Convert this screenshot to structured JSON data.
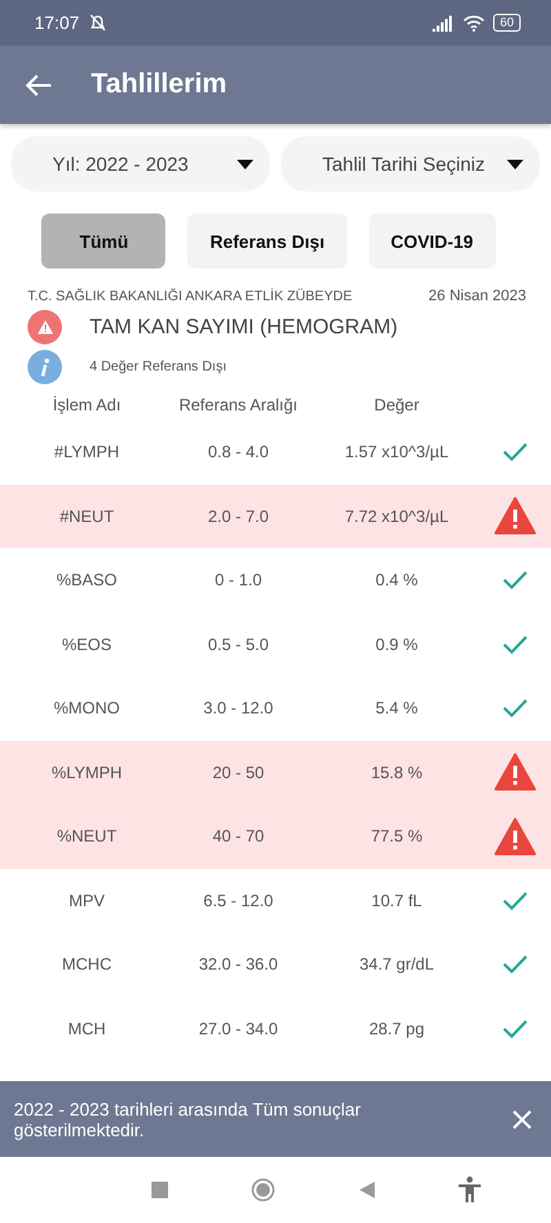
{
  "status_bar": {
    "time": "17:07",
    "battery": "60"
  },
  "app_bar": {
    "title": "Tahlillerim"
  },
  "filters": [
    {
      "label": "Yıl: 2022 - 2023"
    },
    {
      "label": "Tahlil Tarihi Seçiniz"
    }
  ],
  "tabs": [
    {
      "label": "Tümü",
      "selected": true
    },
    {
      "label": "Referans Dışı",
      "selected": false
    },
    {
      "label": "COVID-19",
      "selected": false
    }
  ],
  "report": {
    "institution": "T.C. SAĞLIK BAKANLIĞI ANKARA ETLİK ZÜBEYDE",
    "date": "26 Nisan 2023",
    "test_name": "TAM KAN SAYIMI (HEMOGRAM)",
    "summary": "4 Değer Referans Dışı"
  },
  "table": {
    "columns": [
      "İşlem Adı",
      "Referans Aralığı",
      "Değer"
    ],
    "rows": [
      {
        "name": "#LYMPH",
        "range": "0.8 - 4.0",
        "value": "1.57 x10^3/µL",
        "out_of_range": false
      },
      {
        "name": "#NEUT",
        "range": "2.0 - 7.0",
        "value": "7.72 x10^3/µL",
        "out_of_range": true
      },
      {
        "name": "%BASO",
        "range": "0 - 1.0",
        "value": "0.4 %",
        "out_of_range": false
      },
      {
        "name": "%EOS",
        "range": "0.5 - 5.0",
        "value": "0.9 %",
        "out_of_range": false
      },
      {
        "name": "%MONO",
        "range": "3.0 - 12.0",
        "value": "5.4 %",
        "out_of_range": false
      },
      {
        "name": "%LYMPH",
        "range": "20 - 50",
        "value": "15.8 %",
        "out_of_range": true
      },
      {
        "name": "%NEUT",
        "range": "40 - 70",
        "value": "77.5 %",
        "out_of_range": true
      },
      {
        "name": "MPV",
        "range": "6.5 - 12.0",
        "value": "10.7 fL",
        "out_of_range": false
      },
      {
        "name": "MCHC",
        "range": "32.0 - 36.0",
        "value": "34.7 gr/dL",
        "out_of_range": false
      },
      {
        "name": "MCH",
        "range": "27.0 - 34.0",
        "value": "28.7 pg",
        "out_of_range": false
      }
    ]
  },
  "snackbar": {
    "message": "2022 - 2023 tarihleri arasında Tüm sonuçlar gösterilmektedir."
  }
}
